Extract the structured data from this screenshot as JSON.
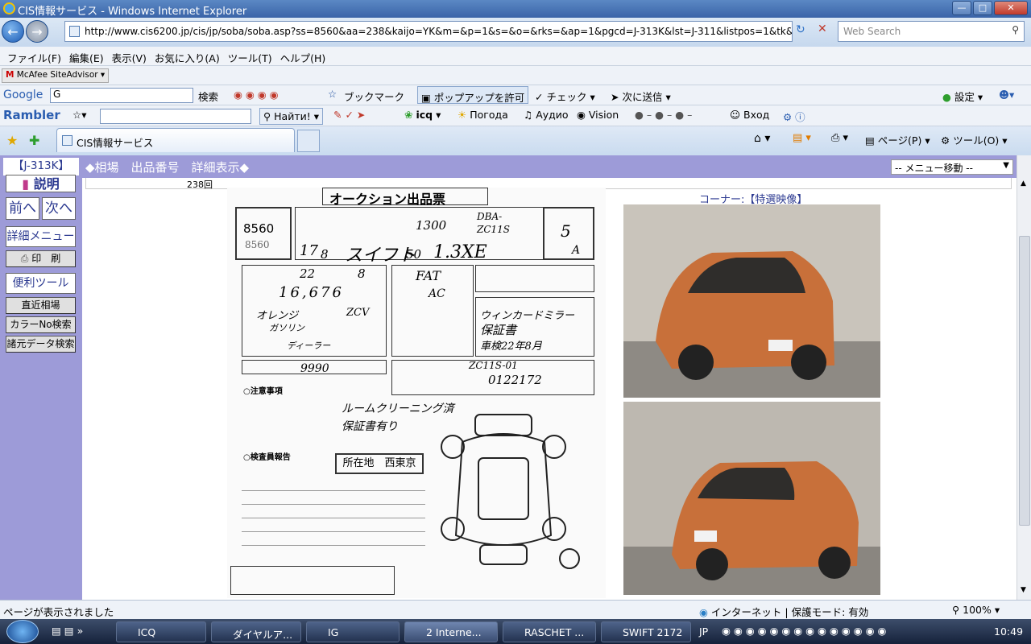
{
  "window": {
    "title": "CIS情報サービス - Windows Internet Explorer"
  },
  "address_bar": {
    "url": "http://www.cis6200.jp/cis/jp/soba/soba.asp?ss=8560&aa=238&kaijo=YK&m=&p=1&s=&o=&rks=&ap=1&pgcd=J-313K&lst=J-311&listpos=1&tk&",
    "search_placeholder": "Web Search"
  },
  "menu": [
    "ファイル(F)",
    "編集(E)",
    "表示(V)",
    "お気に入り(A)",
    "ツール(T)",
    "ヘルプ(H)"
  ],
  "mcafee": {
    "label": "McAfee SiteAdvisor"
  },
  "google_toolbar": {
    "logo": "Google",
    "input_value": "G",
    "search_label": "検索",
    "bookmark": "ブックマーク",
    "popup": "ポップアップを許可",
    "check": "チェック",
    "send": "次に送信",
    "settings": "設定"
  },
  "rambler_toolbar": {
    "logo": "Rambler",
    "find": "Найти!",
    "icq": "icq",
    "weather": "Погода",
    "audio": "Аудио",
    "vision": "Vision",
    "login": "Вход"
  },
  "tab": {
    "title": "CIS情報サービス"
  },
  "command_bar": {
    "page": "ページ(P)",
    "tools": "ツール(O)"
  },
  "page": {
    "code": "【J-313K】",
    "heading": "◆相場　出品番号　詳細表示◆",
    "menu_select": "-- メニュー移動 --",
    "lot_count": "238回",
    "corner": "コーナー:【特選映像】"
  },
  "sidebar": {
    "explain": "説明",
    "prev": "前へ",
    "next": "次へ",
    "detail_menu": "詳細メニュー",
    "print": "印　刷",
    "tools": "便利ツール",
    "recent": "直近相場",
    "color_search": "カラーNo検索",
    "spec_search": "諸元データ検索"
  },
  "sheet": {
    "title": "オークション出品票",
    "lot_number": "8560",
    "lot_number_sub": "8560",
    "year": "17",
    "month": "8",
    "model": "スイフト",
    "displacement": "1300",
    "type_code": "DBA-ZC11S",
    "grade": "1.3XE",
    "grade_prefix": "50",
    "score": "5",
    "interior": "A",
    "inspection_year": "22",
    "inspection_month": "8",
    "mileage": "16,676",
    "shift": "FAT",
    "ac": "AC",
    "color": "オレンジ",
    "color_code": "ZCV",
    "fuel": "ガソリン",
    "dealer": "ディーラー",
    "recycle": "9990",
    "chassis": "0122172",
    "chassis_prefix": "ZC11S-01",
    "sales_point_1": "ウィンカードミラー",
    "sales_point_2": "保証書",
    "sales_point_3": "車検22年8月",
    "notes_1": "ルームクリーニング済",
    "notes_2": "保証書有り",
    "notes_header": "○注意事項",
    "inspector_header": "○検査員報告",
    "location": "所在地　西東京"
  },
  "status_bar": {
    "text": "ページが表示されました",
    "zone": "インターネット | 保護モード: 有効",
    "zoom": "100%"
  },
  "taskbar": {
    "items": [
      "ICQ",
      "ダイヤルア...",
      "IG",
      "2 Interne...",
      "RASCHET ...",
      "SWIFT 2172"
    ],
    "lang": "JP",
    "time": "10:49"
  }
}
